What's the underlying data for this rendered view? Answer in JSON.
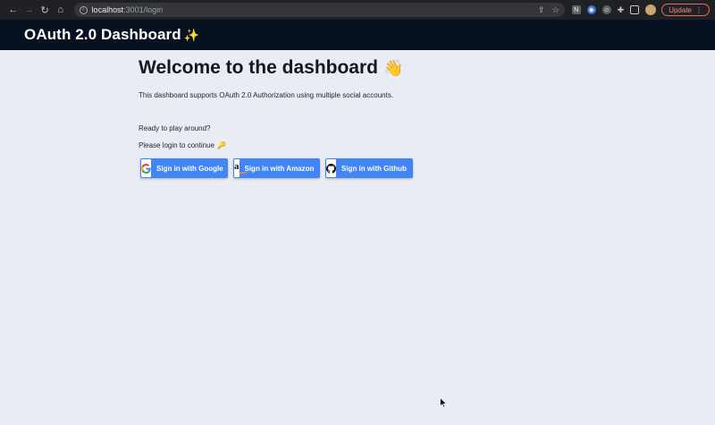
{
  "browser": {
    "url_host": "localhost",
    "url_path": ":3001/login",
    "update_label": "Update"
  },
  "header": {
    "title": "OAuth 2.0 Dashboard",
    "title_emoji": "✨"
  },
  "main": {
    "heading": "Welcome to the dashboard",
    "heading_emoji": "👋",
    "description": "This dashboard supports OAuth 2.0 Authorization using multiple social accounts.",
    "ready_text": "Ready to play around?",
    "login_prompt": "Please login to continue",
    "login_emoji": "🔑"
  },
  "buttons": {
    "google": "Sign in with Google",
    "amazon": "Sign in with Amazon",
    "github": "Sign in with Github"
  },
  "colors": {
    "header_bg": "#061222",
    "page_bg": "#e9ecf2",
    "button_blue": "#4285f4"
  }
}
